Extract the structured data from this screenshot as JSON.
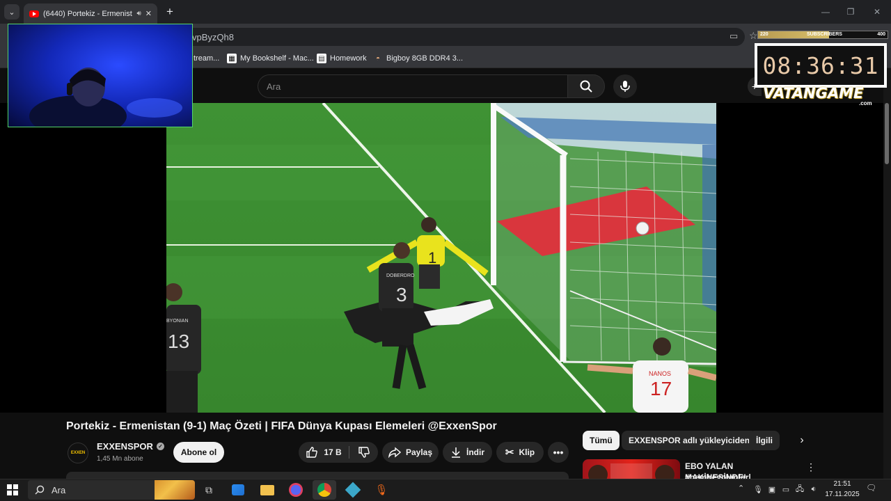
{
  "browser": {
    "tab_title": "(6440) Portekiz - Ermenistan",
    "new_tab": "+",
    "tab_list": "⌄",
    "url_fragment": "vpByzQh8",
    "window_controls": {
      "minimize": "—",
      "restore": "❐",
      "close": "✕"
    },
    "bookmarks": [
      {
        "label": "tream..."
      },
      {
        "label": "My Bookshelf - Mac..."
      },
      {
        "label": "Homework"
      },
      {
        "label": "Bigboy 8GB DDR4 3..."
      }
    ]
  },
  "youtube": {
    "search_placeholder": "Ara",
    "create_label": "+"
  },
  "overlay": {
    "subscribers": {
      "current": "220",
      "label": "SUBSCRIBERS",
      "goal": "400",
      "progress": 0.55
    },
    "timer": "08:36:31",
    "brand": "VATANGAME",
    "brand_suffix": ".com"
  },
  "video": {
    "title": "Portekiz - Ermenistan (9-1) Maç Özeti | FIFA Dünya Kupası Elemeleri @ExxenSpor",
    "channel": "EXXENSPOR",
    "channel_badge_text": "EXXEN",
    "subscribers": "1,45 Mn abone",
    "subscribe_label": "Abone ol",
    "likes": "17 B",
    "share_label": "Paylaş",
    "download_label": "İndir",
    "clip_label": "Klip",
    "players": {
      "shirt_1": "1",
      "shirt_3": "3",
      "shirt_13": "13",
      "shirt_17": "17",
      "name_3": "DOBERDRO",
      "name_13": "BYONIAN",
      "name_17": "NANOS"
    }
  },
  "recommendations": {
    "chips": [
      "Tümü",
      "EXXENSPOR adlı yükleyiciden",
      "İlgili"
    ],
    "first_title": "EBO YALAN MAKİNESİNDE! |",
    "first_subtitle": "#pembeyolanlar"
  },
  "taskbar": {
    "search_placeholder": "Ara",
    "time": "21:51",
    "date": "17.11.2025"
  }
}
